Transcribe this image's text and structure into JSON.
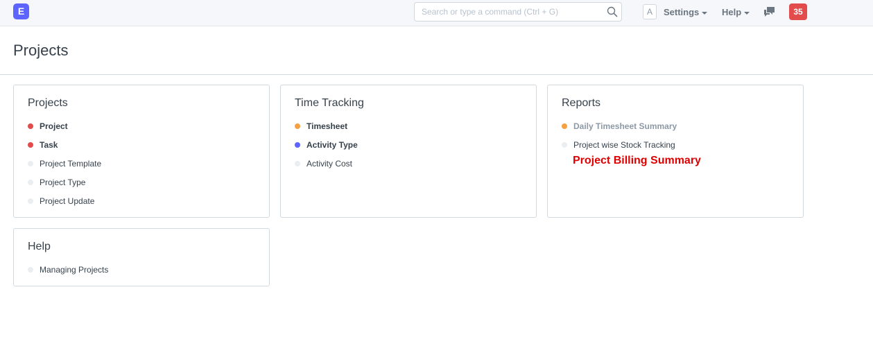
{
  "navbar": {
    "logo_letter": "E",
    "search_placeholder": "Search or type a command (Ctrl + G)",
    "avatar_letter": "A",
    "settings_label": "Settings",
    "help_label": "Help",
    "notification_count": "35"
  },
  "page": {
    "title": "Projects"
  },
  "cards": {
    "projects": {
      "title": "Projects",
      "items": [
        {
          "label": "Project",
          "bold": true,
          "dot_color": "#e24c4c"
        },
        {
          "label": "Task",
          "bold": true,
          "dot_color": "#e24c4c"
        },
        {
          "label": "Project Template",
          "bold": false,
          "dot_color": "#ebeef0"
        },
        {
          "label": "Project Type",
          "bold": false,
          "dot_color": "#ebeef0"
        },
        {
          "label": "Project Update",
          "bold": false,
          "dot_color": "#ebeef0"
        }
      ]
    },
    "time_tracking": {
      "title": "Time Tracking",
      "items": [
        {
          "label": "Timesheet",
          "bold": true,
          "dot_color": "#f5a041"
        },
        {
          "label": "Activity Type",
          "bold": true,
          "dot_color": "#5e64ff"
        },
        {
          "label": "Activity Cost",
          "bold": false,
          "dot_color": "#ebeef0"
        }
      ]
    },
    "reports": {
      "title": "Reports",
      "items": [
        {
          "label": "Daily Timesheet Summary",
          "bold": true,
          "muted": true,
          "dot_color": "#f5a041"
        },
        {
          "label": "Project wise Stock Tracking",
          "bold": false,
          "dot_color": "#ebeef0"
        }
      ],
      "annotation": "Project Billing Summary"
    },
    "help": {
      "title": "Help",
      "items": [
        {
          "label": "Managing Projects",
          "bold": false,
          "dot_color": "#ebeef0"
        }
      ]
    }
  }
}
